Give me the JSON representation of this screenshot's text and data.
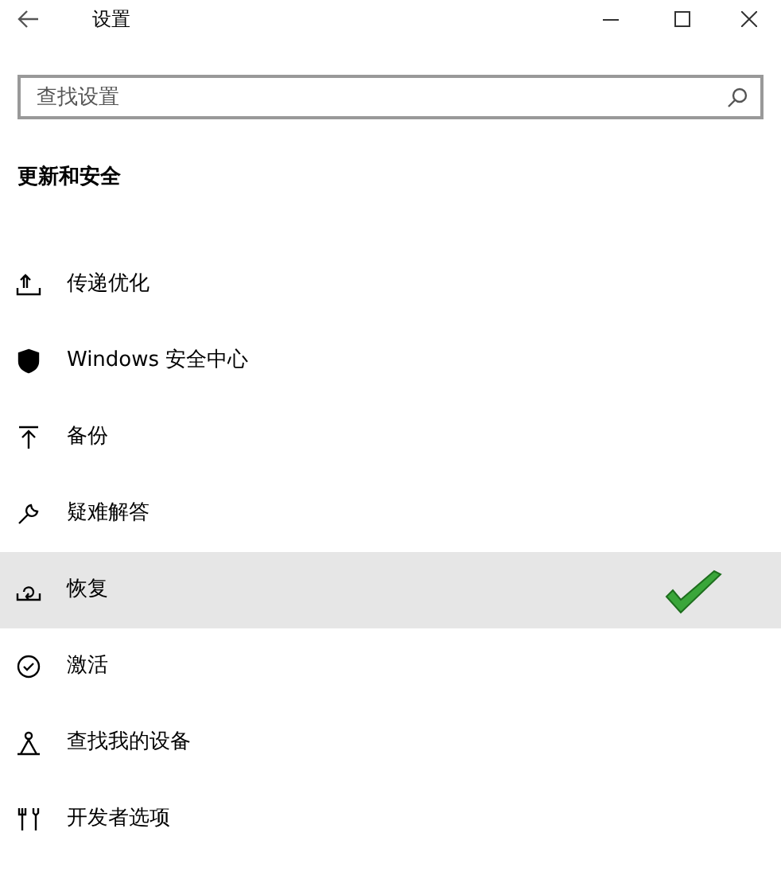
{
  "window": {
    "title": "设置"
  },
  "search": {
    "placeholder": "查找设置"
  },
  "section": {
    "title": "更新和安全"
  },
  "items": [
    {
      "label": "传递优化",
      "kind": "delivery",
      "selected": false
    },
    {
      "label": "Windows 安全中心",
      "kind": "shield",
      "selected": false
    },
    {
      "label": "备份",
      "kind": "backup",
      "selected": false
    },
    {
      "label": "疑难解答",
      "kind": "wrench",
      "selected": false
    },
    {
      "label": "恢复",
      "kind": "recovery",
      "selected": true
    },
    {
      "label": "激活",
      "kind": "activation",
      "selected": false
    },
    {
      "label": "查找我的设备",
      "kind": "person",
      "selected": false
    },
    {
      "label": "开发者选项",
      "kind": "tools",
      "selected": false
    }
  ]
}
